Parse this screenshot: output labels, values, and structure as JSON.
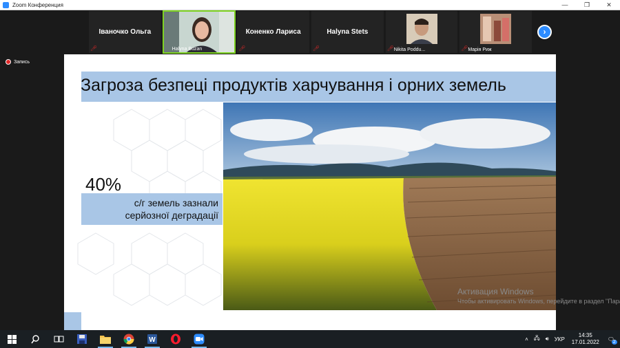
{
  "window": {
    "title": "Zoom Конференция",
    "controls": [
      "—",
      "❐",
      "✕"
    ]
  },
  "participants": [
    {
      "name": "Іваночко Ольга",
      "muted": true,
      "video": false
    },
    {
      "name": "Halyna Buzan",
      "muted": false,
      "video": true,
      "active": true
    },
    {
      "name": "Коненко Лариса",
      "muted": true,
      "video": false
    },
    {
      "name": "Halyna Stets",
      "muted": true,
      "video": false
    },
    {
      "name": "Nikita Poddu...",
      "muted": true,
      "video": true
    },
    {
      "name": "Марія Риж",
      "muted": true,
      "video": true
    }
  ],
  "recording": {
    "label": "Запись"
  },
  "slide": {
    "title": "Загроза безпеці продуктів харчування і орних земель",
    "stat_value": "40%",
    "stat_caption_line1": "с/г земель зазнали",
    "stat_caption_line2": "серйозної деградації"
  },
  "watermark": {
    "line1": "Активация Windows",
    "line2": "Чтобы активировать Windows, перейдите в раздел \"Параметры\"."
  },
  "taskbar": {
    "apps": [
      "windows-start-icon",
      "search-icon",
      "task-view-icon",
      "save-app-icon",
      "file-explorer-icon",
      "chrome-icon",
      "word-icon",
      "opera-icon",
      "zoom-icon"
    ],
    "language": "УКР",
    "time": "14:35",
    "date": "17.01.2022",
    "notification_count": "2"
  },
  "colors": {
    "accent_blue": "#a9c6e6",
    "active_speaker": "#7ed321",
    "zoom_blue": "#2d8cff",
    "recording_red": "#e02828"
  }
}
